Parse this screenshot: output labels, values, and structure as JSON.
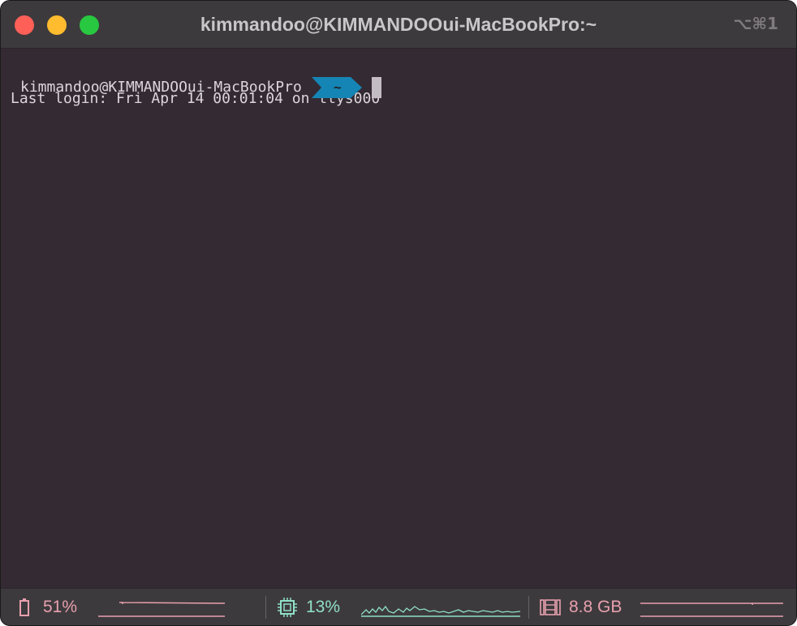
{
  "window": {
    "title": "kimmandoo@KIMMANDOOui-MacBookPro:~",
    "shortcut": "⌥⌘1"
  },
  "terminal": {
    "last_login": "Last login: Fri Apr 14 00:01:04 on ttys000",
    "prompt_user_host": "kimmandoo@KIMMANDOOui-MacBookPro",
    "prompt_dir": "~"
  },
  "status_bar": {
    "battery": {
      "icon": "battery-icon",
      "value": "51%",
      "color": "#e8a0ae"
    },
    "cpu": {
      "icon": "cpu-icon",
      "value": "13%",
      "color": "#8fe0c4"
    },
    "memory": {
      "icon": "memory-icon",
      "value": "8.8 GB",
      "color": "#e8a0ae"
    }
  },
  "colors": {
    "background": "#342a33",
    "titlebar": "#3d3a3d",
    "prompt_segment": "#1585b5",
    "close": "#fe5f57",
    "minimize": "#febc2e",
    "maximize": "#28c840"
  }
}
